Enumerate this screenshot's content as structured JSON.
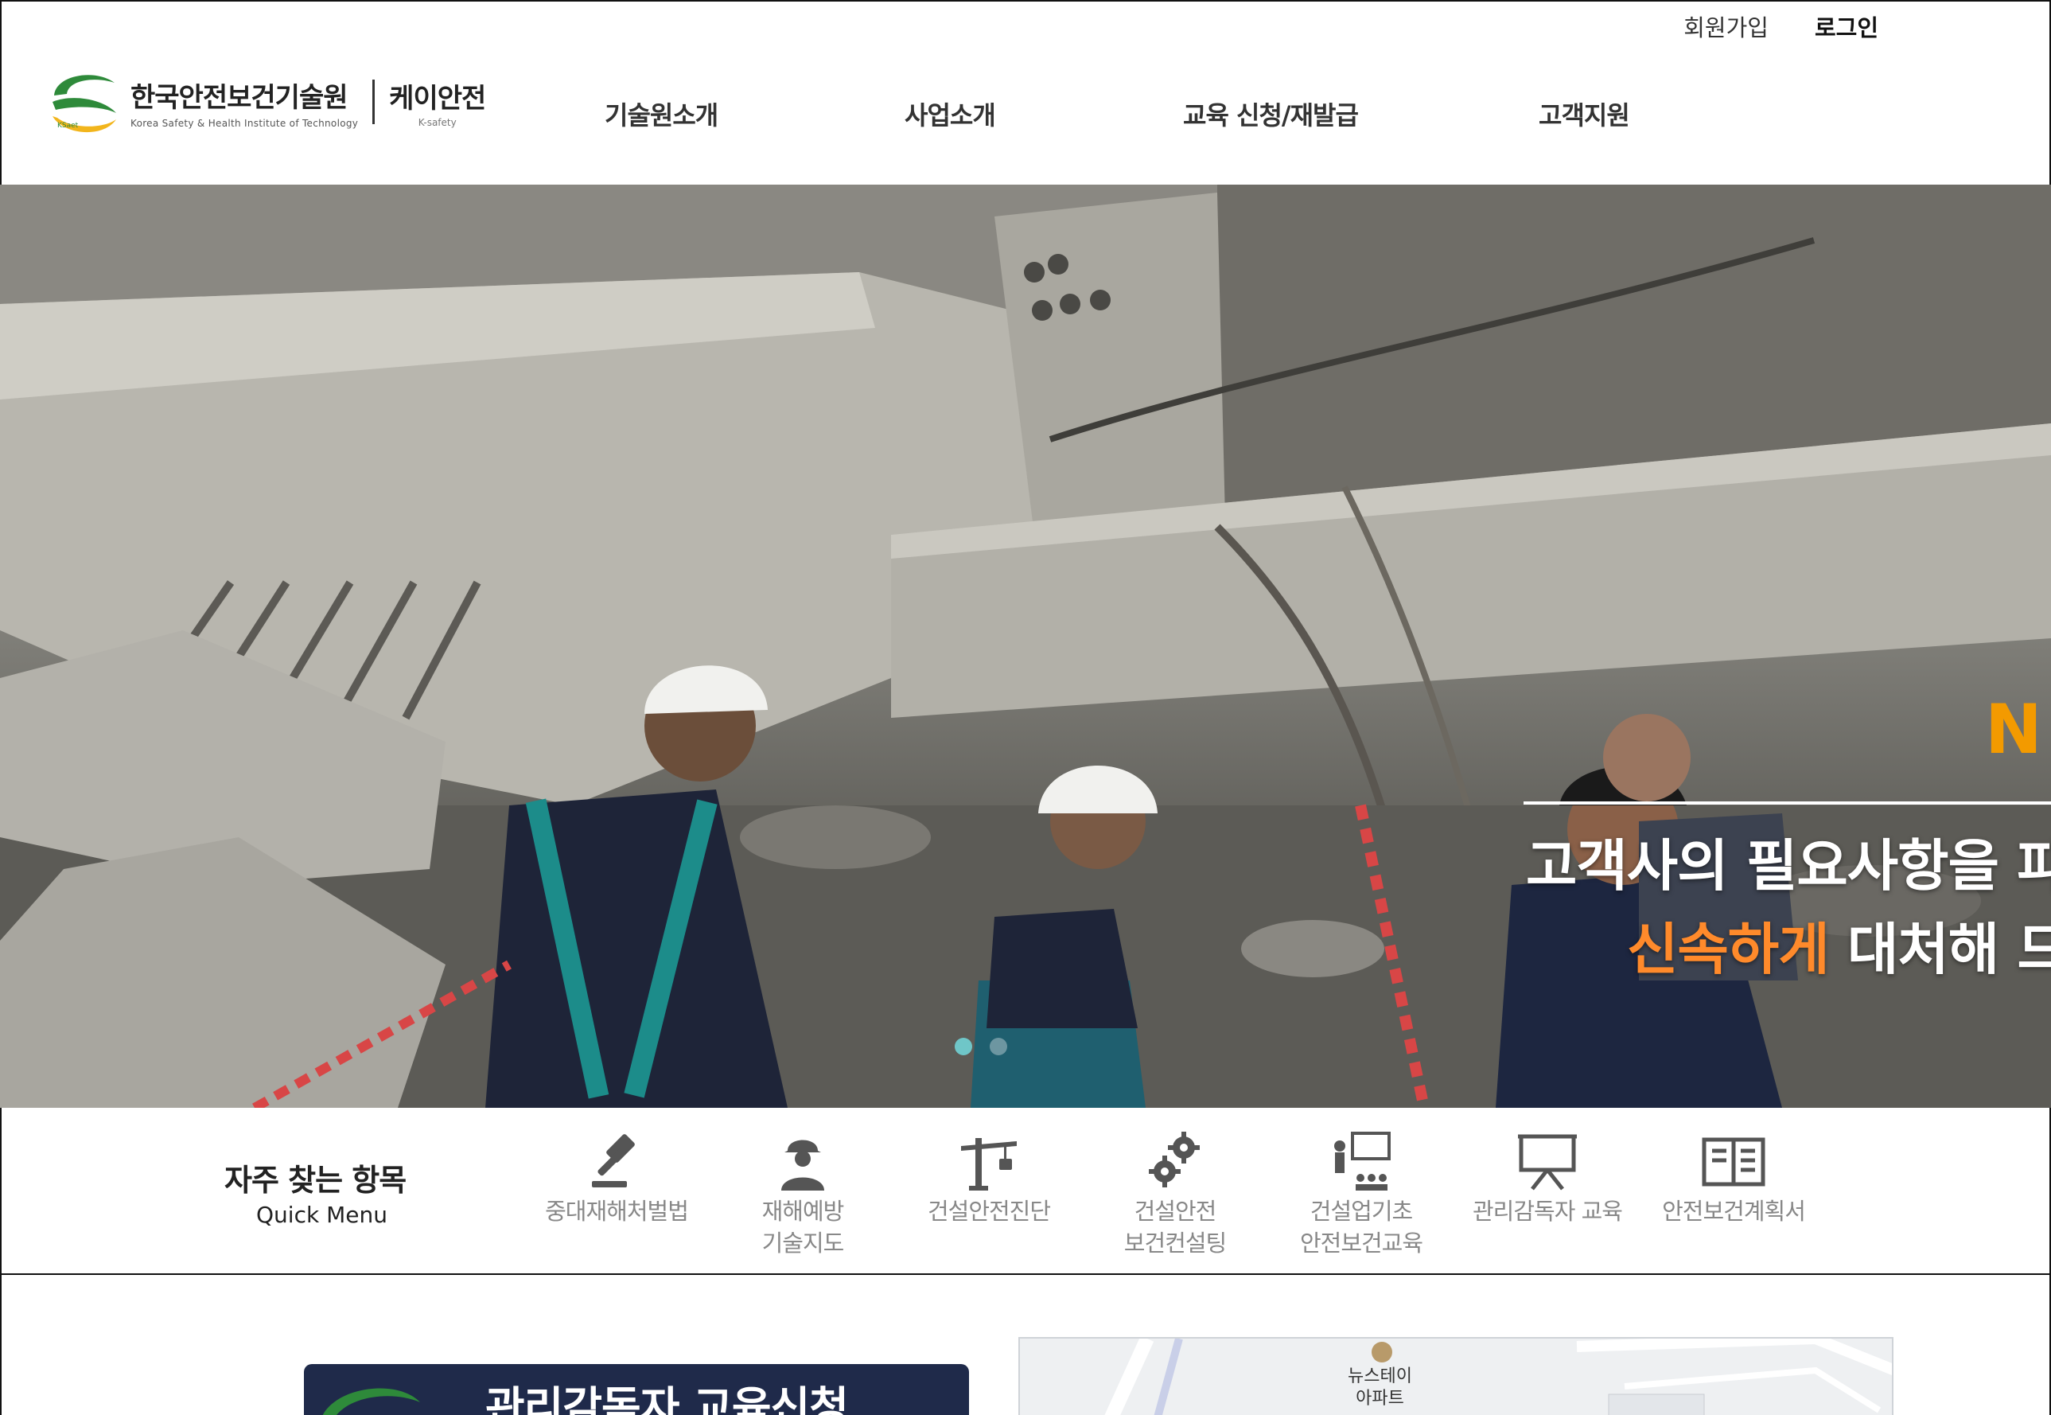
{
  "header": {
    "util": {
      "join_label": "회원가입",
      "login_label": "로그인"
    },
    "logo": {
      "name_kor": "한국안전보건기술원",
      "name_eng": "Korea Safety & Health Institute of Technology",
      "sub_kor": "케이안전",
      "sub_eng": "K-safety"
    },
    "nav": [
      {
        "label": "기술원소개"
      },
      {
        "label": "사업소개"
      },
      {
        "label": "교육 신청/재발급"
      },
      {
        "label": "고객지원"
      }
    ]
  },
  "hero": {
    "heading_fragment": "N",
    "line1": "고객사의 필요사항을 파",
    "line2_accent": "신속하게",
    "line2_rest": " 대처해 드",
    "slides": 2,
    "active_slide": 1
  },
  "quick_menu": {
    "title": "자주 찾는 항목",
    "subtitle": "Quick Menu",
    "items": [
      {
        "icon": "gavel-icon",
        "line1": "중대재해처벌법",
        "line2": ""
      },
      {
        "icon": "worker-icon",
        "line1": "재해예방",
        "line2": "기술지도"
      },
      {
        "icon": "crane-icon",
        "line1": "건설안전진단",
        "line2": ""
      },
      {
        "icon": "gears-icon",
        "line1": "건설안전",
        "line2": "보건컨설팅"
      },
      {
        "icon": "lecture-icon",
        "line1": "건설업기초",
        "line2": "안전보건교육"
      },
      {
        "icon": "presentation-board-icon",
        "line1": "관리감독자 교육",
        "line2": ""
      },
      {
        "icon": "open-book-icon",
        "line1": "안전보건계획서",
        "line2": ""
      }
    ]
  },
  "bottom": {
    "banner_title": "관리감독자 교육신청",
    "map_label_1": "뉴스테이",
    "map_label_2": "아파트"
  },
  "colors": {
    "accent_orange": "#ff8a2b",
    "heading_orange": "#f39a00",
    "slider_active": "#6fc6c8",
    "banner_navy": "#1f2a4a",
    "logo_green": "#2e8a3a",
    "logo_yellow": "#f2b51c"
  }
}
